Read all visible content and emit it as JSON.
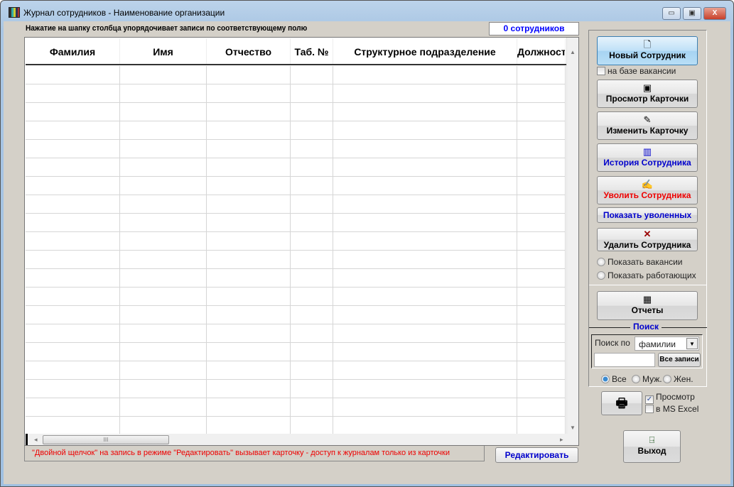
{
  "window": {
    "title": "Журнал сотрудников -  Наименование организации",
    "min": "▭",
    "max": "▣",
    "close": "X"
  },
  "hint": "Нажатие на шапку столбца упорядочивает записи  по соответствующему полю",
  "count": "0 сотрудников",
  "grid": {
    "columns": [
      "Фамилия",
      "Имя",
      "Отчество",
      "Таб. №",
      "Структурное подразделение",
      "Должност"
    ],
    "row_count": 20,
    "scroll_thumb": "III"
  },
  "note": "\"Двойной щелчок\" на запись в режиме \"Редактировать\" вызывает карточку  -  доступ к журналам только из карточки",
  "edit_button": "Редактировать",
  "panel": {
    "new": "Новый Сотрудник",
    "on_vacancy": "на базе вакансии",
    "view": "Просмотр Карточки",
    "change": "Изменить Карточку",
    "history": "История Сотрудника",
    "dismiss": "Уволить Сотрудника",
    "show_dismissed": "Показать уволенных",
    "delete": "Удалить Сотрудника",
    "show_vacancies": "Показать вакансии",
    "show_working": "Показать работающих",
    "reports": "Отчеты",
    "search": {
      "legend": "Поиск",
      "label": "Поиск по",
      "field_value": "фамилии",
      "input_value": "",
      "all_records": "Все записи",
      "gender": [
        "Все",
        "Муж.",
        "Жен."
      ]
    }
  },
  "print": {
    "preview": "Просмотр",
    "excel": "в MS Excel",
    "preview_checked": true,
    "excel_checked": false
  },
  "exit": "Выход",
  "colors": {
    "blue": "#0000ff",
    "red": "#ee0000",
    "panel": "#d4d0c8"
  }
}
